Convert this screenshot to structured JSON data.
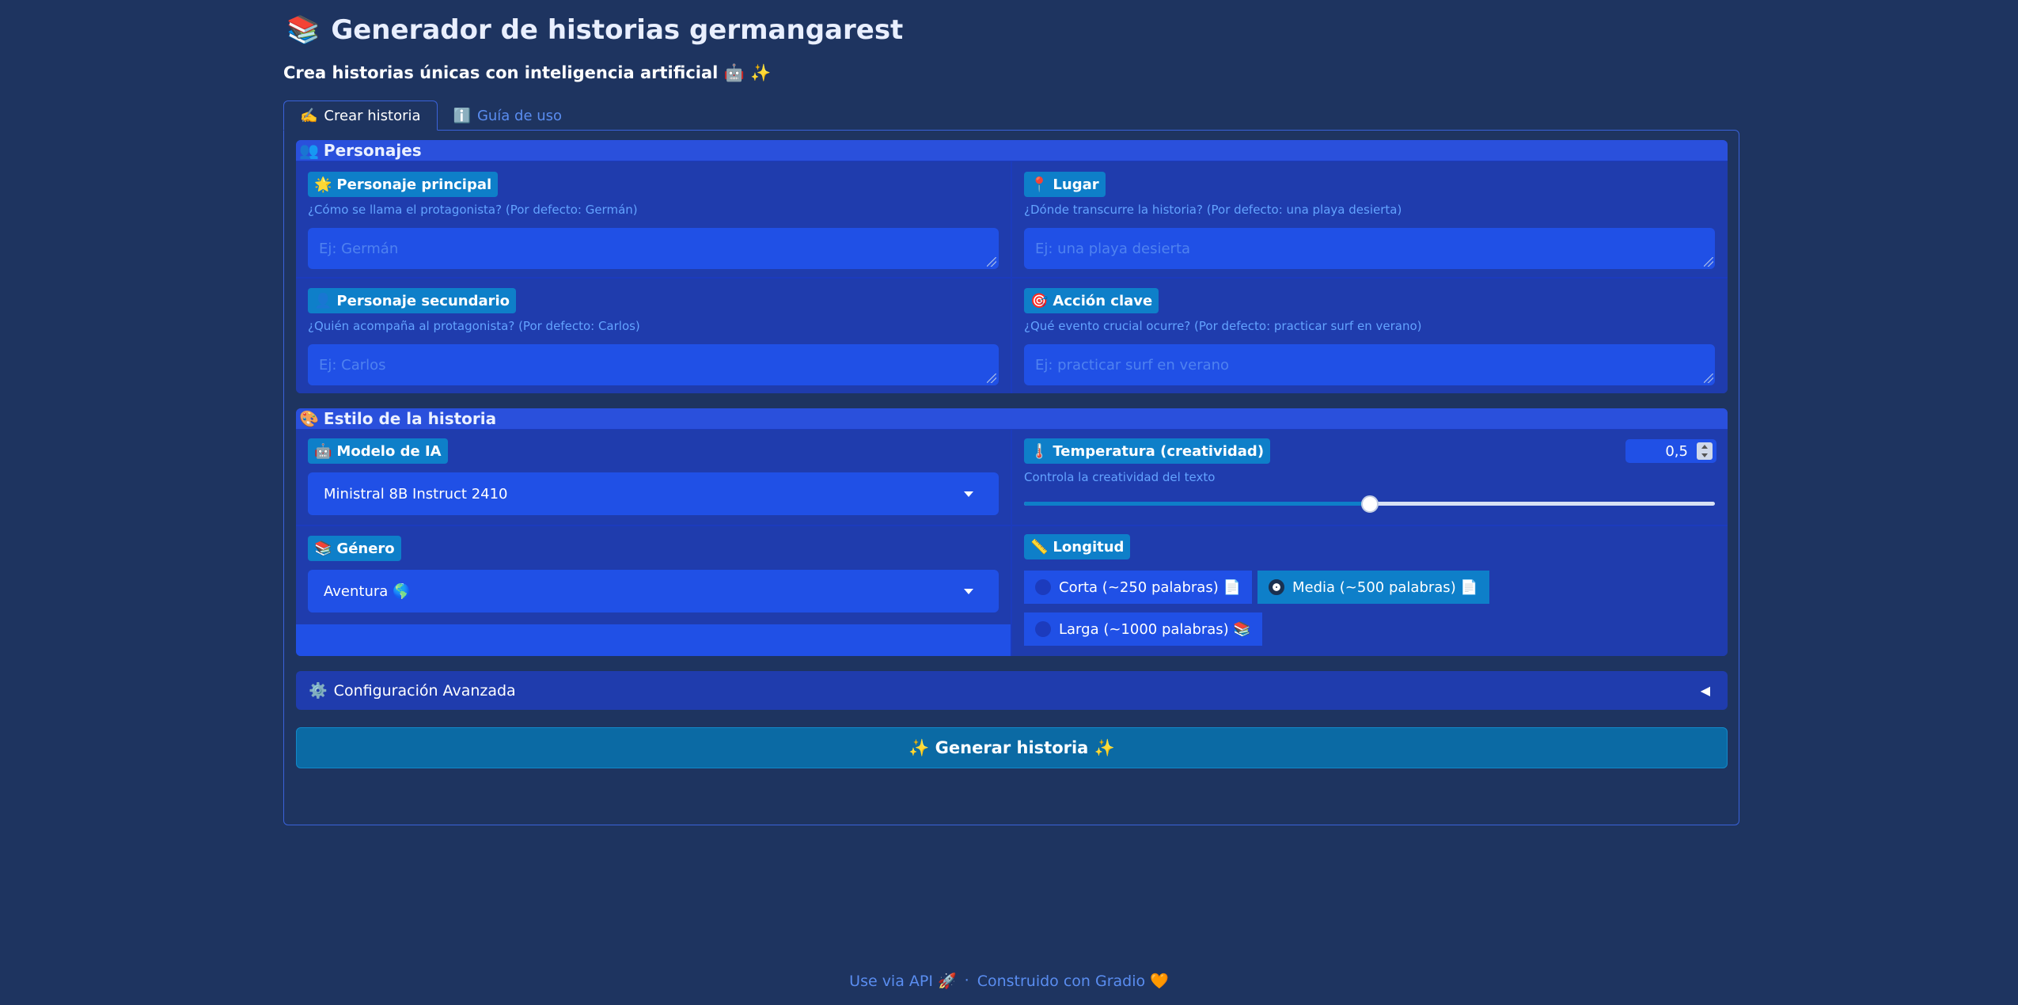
{
  "app": {
    "title": "Generador de historias germangarest",
    "title_icon": "📚",
    "subtitle": "Crea historias únicas con inteligencia artificial 🤖 ✨"
  },
  "tabs": [
    {
      "icon": "✍️",
      "label": "Crear historia",
      "active": true
    },
    {
      "icon": "ℹ️",
      "label": "Guía de uso",
      "active": false
    }
  ],
  "characters_group": {
    "icon": "👥",
    "title": "Personajes",
    "fields": {
      "main_character": {
        "icon": "🌟",
        "label": "Personaje principal",
        "hint": "¿Cómo se llama el protagonista? (Por defecto: Germán)",
        "placeholder": "Ej: Germán",
        "value": ""
      },
      "place": {
        "icon": "📍",
        "label": "Lugar",
        "hint": "¿Dónde transcurre la historia? (Por defecto: una playa desierta)",
        "placeholder": "Ej: una playa desierta",
        "value": ""
      },
      "secondary_character": {
        "icon": "👤",
        "label": "Personaje secundario",
        "hint": "¿Quién acompaña al protagonista? (Por defecto: Carlos)",
        "placeholder": "Ej: Carlos",
        "value": ""
      },
      "key_action": {
        "icon": "🎯",
        "label": "Acción clave",
        "hint": "¿Qué evento crucial ocurre? (Por defecto: practicar surf en verano)",
        "placeholder": "Ej: practicar surf en verano",
        "value": ""
      }
    }
  },
  "style_group": {
    "icon": "🎨",
    "title": "Estilo de la historia",
    "model": {
      "icon": "🤖",
      "label": "Modelo de IA",
      "selected": "Ministral 8B Instruct 2410"
    },
    "temperature": {
      "icon": "🌡️",
      "label": "Temperatura (creatividad)",
      "hint": "Controla la creatividad del texto",
      "value_text": "0,5",
      "value": 0.5,
      "min": 0,
      "max": 1
    },
    "genre": {
      "icon": "📚",
      "label": "Género",
      "selected": "Aventura 🌎"
    },
    "length": {
      "icon": "📏",
      "label": "Longitud",
      "options": [
        {
          "label": "Corta (~250 palabras) 📄",
          "selected": false
        },
        {
          "label": "Media (~500 palabras) 📄",
          "selected": true
        },
        {
          "label": "Larga (~1000 palabras) 📚",
          "selected": false
        }
      ]
    }
  },
  "advanced": {
    "icon": "⚙️",
    "label": "Configuración Avanzada",
    "arrow": "◀"
  },
  "generate_button": {
    "label": "✨ Generar historia ✨"
  },
  "footer": {
    "api_link": "Use via API 🚀",
    "separator": "·",
    "built_with": "Construido con Gradio 🧡"
  },
  "colors": {
    "background": "#1e3460",
    "group_bg": "#1c3bbd",
    "input_bg": "#2050e6",
    "badge_bg": "#0e7fc9",
    "button_bg": "#0b6aa4",
    "link": "#5a8df0"
  }
}
